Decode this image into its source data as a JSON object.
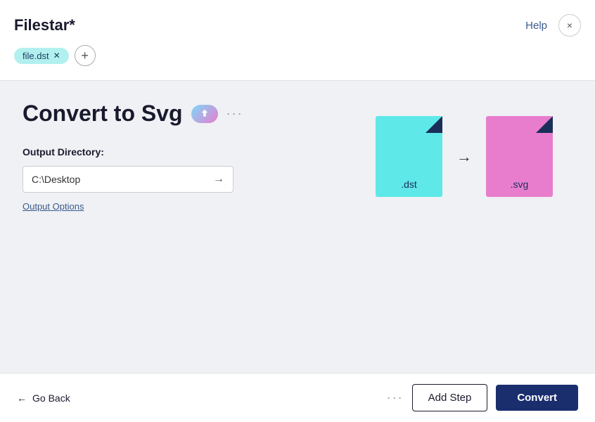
{
  "app": {
    "title": "Filestar",
    "title_star": "*"
  },
  "header": {
    "help_label": "Help",
    "close_label": "×"
  },
  "tabs": {
    "items": [
      {
        "label": "file.dst"
      }
    ],
    "add_label": "+"
  },
  "main": {
    "page_title": "Convert to Svg",
    "output_directory_label": "Output Directory:",
    "directory_value": "C:\\Desktop",
    "output_options_label": "Output Options",
    "more_label": "···"
  },
  "files": {
    "source_ext": ".dst",
    "target_ext": ".svg"
  },
  "footer": {
    "go_back_label": "Go Back",
    "more_label": "···",
    "add_step_label": "Add Step",
    "convert_label": "Convert"
  }
}
